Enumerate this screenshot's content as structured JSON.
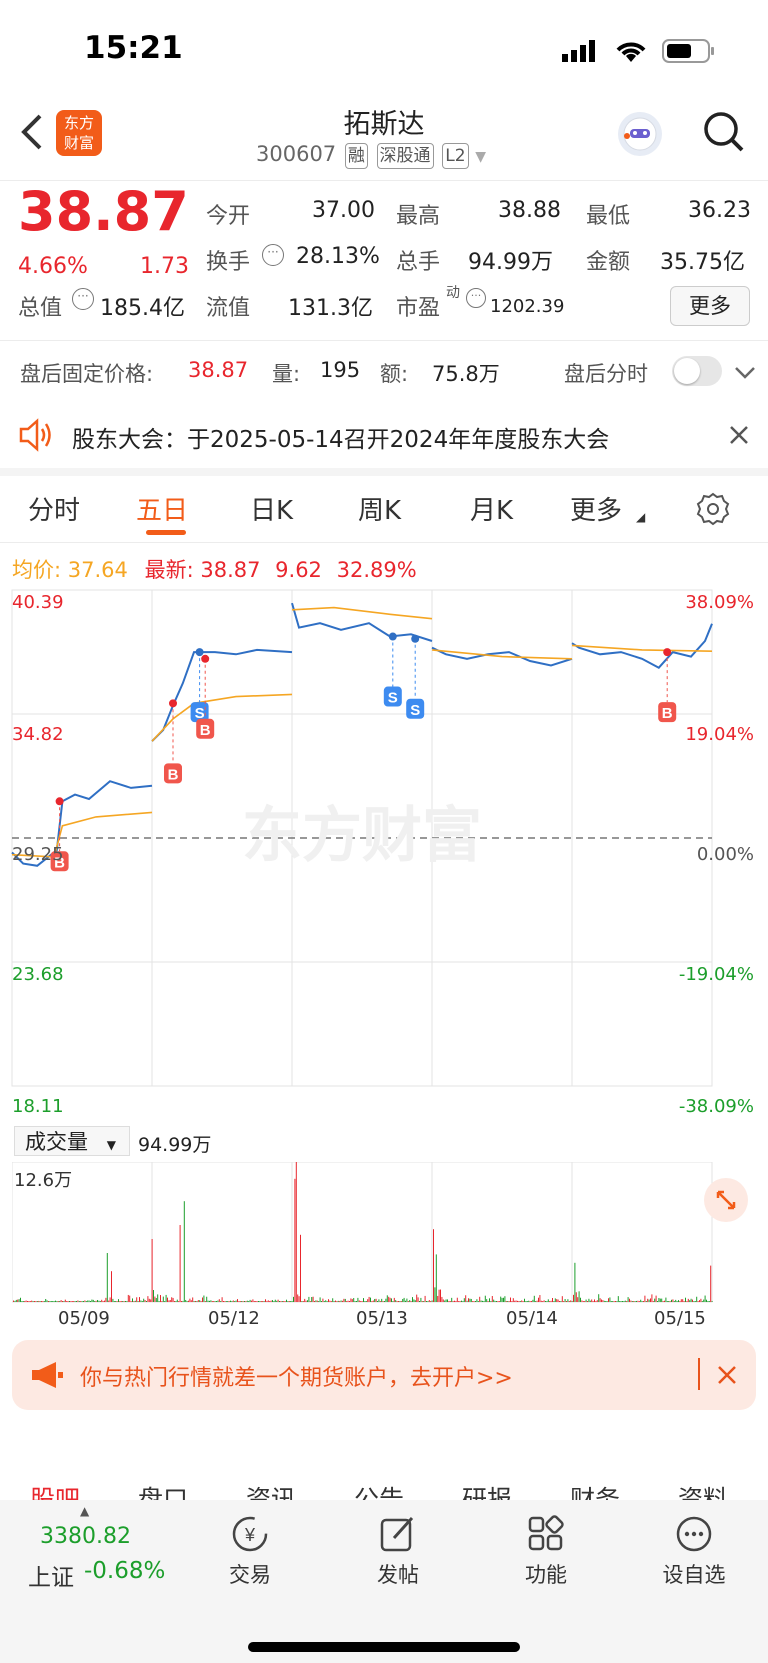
{
  "status": {
    "time": "15:21"
  },
  "header": {
    "logo_text": "东方财富",
    "stock_name": "拓斯达",
    "stock_code": "300607",
    "tags": [
      "融",
      "深股通",
      "L2"
    ]
  },
  "quote": {
    "price": "38.87",
    "change_pct": "4.66%",
    "change": "1.73",
    "open_label": "今开",
    "open": "37.00",
    "high_label": "最高",
    "high": "38.88",
    "low_label": "最低",
    "low": "36.23",
    "turnover_label": "换手",
    "turnover": "28.13%",
    "volume_label": "总手",
    "volume": "94.99万",
    "amount_label": "金额",
    "amount": "35.75亿",
    "mktcap_label": "总值",
    "mktcap": "185.4亿",
    "float_label": "流值",
    "float": "131.3亿",
    "pe_label": "市盈",
    "pe_sup": "动",
    "pe": "1202.39",
    "more_label": "更多"
  },
  "afterhours": {
    "fixed_label": "盘后固定价格:",
    "fixed_price": "38.87",
    "vol_label": "量:",
    "vol": "195",
    "amt_label": "额:",
    "amt": "75.8万",
    "switch_label": "盘后分时"
  },
  "notice": {
    "text": "股东大会：于2025-05-14召开2024年年度股东大会"
  },
  "tabs": [
    "分时",
    "五日",
    "日K",
    "周K",
    "月K",
    "更多"
  ],
  "active_tab": "五日",
  "chart_info": {
    "avg_label": "均价:",
    "avg": "37.64",
    "latest_label": "最新:",
    "latest": "38.87",
    "latest_chg": "9.62",
    "latest_pct": "32.89%"
  },
  "chart_data": {
    "type": "line",
    "y_left": [
      "40.39",
      "34.82",
      "29.25",
      "23.68",
      "18.11"
    ],
    "y_right": [
      "38.09%",
      "19.04%",
      "0.00%",
      "-19.04%",
      "-38.09%"
    ],
    "ylim": [
      18.11,
      40.39
    ],
    "base": 29.25,
    "x_dates": [
      "05/09",
      "05/12",
      "05/13",
      "05/14",
      "05/15"
    ],
    "watermark": "东方财富",
    "series": [
      {
        "name": "price",
        "color": "#2f6fc4",
        "values": [
          [
            0,
            28.6
          ],
          [
            0.08,
            28.1
          ],
          [
            0.18,
            28.0
          ],
          [
            0.32,
            28.7
          ],
          [
            0.36,
            30.9
          ],
          [
            0.45,
            31.2
          ],
          [
            0.55,
            31.0
          ],
          [
            0.7,
            31.8
          ],
          [
            0.85,
            31.5
          ],
          [
            1.0,
            31.6
          ],
          [
            1.0,
            33.6
          ],
          [
            1.08,
            34.1
          ],
          [
            1.15,
            35.2
          ],
          [
            1.22,
            36.2
          ],
          [
            1.3,
            37.6
          ],
          [
            1.45,
            37.6
          ],
          [
            1.6,
            37.5
          ],
          [
            1.75,
            37.7
          ],
          [
            2.0,
            37.6
          ],
          [
            2.0,
            39.8
          ],
          [
            2.05,
            38.7
          ],
          [
            2.2,
            38.9
          ],
          [
            2.35,
            38.6
          ],
          [
            2.55,
            38.9
          ],
          [
            2.7,
            38.3
          ],
          [
            2.85,
            38.4
          ],
          [
            3.0,
            38.1
          ],
          [
            3.0,
            37.8
          ],
          [
            3.1,
            37.5
          ],
          [
            3.25,
            37.3
          ],
          [
            3.4,
            37.5
          ],
          [
            3.55,
            37.6
          ],
          [
            3.7,
            37.2
          ],
          [
            3.85,
            37.0
          ],
          [
            4.0,
            37.3
          ],
          [
            4.0,
            38.0
          ],
          [
            4.05,
            37.8
          ],
          [
            4.2,
            37.5
          ],
          [
            4.35,
            37.6
          ],
          [
            4.5,
            37.3
          ],
          [
            4.62,
            36.9
          ],
          [
            4.72,
            37.6
          ],
          [
            4.85,
            37.4
          ],
          [
            4.95,
            38.1
          ],
          [
            5.0,
            38.87
          ]
        ]
      },
      {
        "name": "均价",
        "color": "#f5a623",
        "values": [
          [
            0,
            28.5
          ],
          [
            0.3,
            28.4
          ],
          [
            0.36,
            29.8
          ],
          [
            0.6,
            30.2
          ],
          [
            1.0,
            30.4
          ],
          [
            1.0,
            33.6
          ],
          [
            1.15,
            34.6
          ],
          [
            1.3,
            35.3
          ],
          [
            1.6,
            35.6
          ],
          [
            2.0,
            35.7
          ],
          [
            2.0,
            39.5
          ],
          [
            2.3,
            39.6
          ],
          [
            2.7,
            39.3
          ],
          [
            3.0,
            39.1
          ],
          [
            3.0,
            37.7
          ],
          [
            3.5,
            37.4
          ],
          [
            4.0,
            37.3
          ],
          [
            4.0,
            37.9
          ],
          [
            4.5,
            37.7
          ],
          [
            5.0,
            37.64
          ]
        ]
      }
    ],
    "trades": [
      {
        "type": "B",
        "x": 0.34,
        "y": 30.9
      },
      {
        "type": "B",
        "x": 1.15,
        "y": 35.3
      },
      {
        "type": "S",
        "x": 1.34,
        "y": 37.6
      },
      {
        "type": "B",
        "x": 1.38,
        "y": 37.3
      },
      {
        "type": "S",
        "x": 2.72,
        "y": 38.3
      },
      {
        "type": "S",
        "x": 2.88,
        "y": 38.2
      },
      {
        "type": "B",
        "x": 4.68,
        "y": 37.6
      }
    ]
  },
  "volume": {
    "label": "成交量",
    "total": "94.99万",
    "max": "12.6万",
    "up_color": "#e8262d",
    "down_color": "#1c9e2b"
  },
  "banner": {
    "text": "你与热门行情就差一个期货账户，去开户>>"
  },
  "subtabs": [
    "股吧",
    "盘口",
    "资讯",
    "公告",
    "研报",
    "财务",
    "资料"
  ],
  "bottom": {
    "index_value": "3380.82",
    "index_name": "上证",
    "index_change": "-0.68%",
    "items": [
      "交易",
      "发帖",
      "功能",
      "设自选"
    ]
  }
}
